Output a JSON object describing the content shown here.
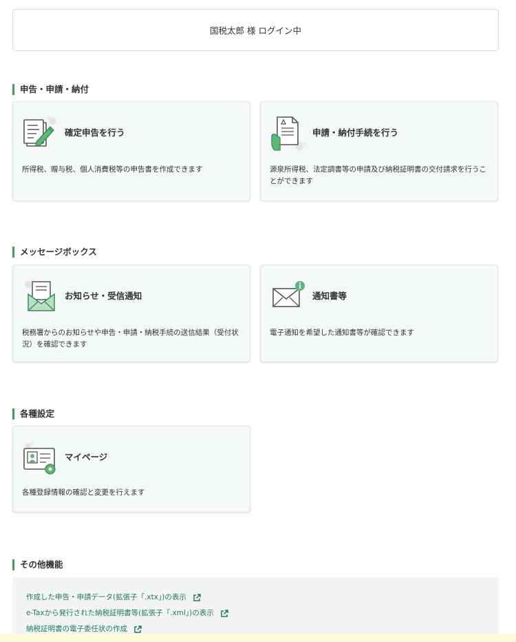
{
  "header": {
    "login_status": "国税太郎 様 ログイン中"
  },
  "sections": {
    "filing": {
      "title": "申告・申請・納付",
      "cards": [
        {
          "title": "確定申告を行う",
          "description": "所得税、贈与税、個人消費税等の申告書を作成できます",
          "icon": "document-pen-icon"
        },
        {
          "title": "申請・納付手続を行う",
          "description": "源泉所得税、法定調書等の申請及び納税証明書の交付請求を行うことができます",
          "icon": "hand-document-icon"
        }
      ]
    },
    "messagebox": {
      "title": "メッセージボックス",
      "cards": [
        {
          "title": "お知らせ・受信通知",
          "description": "税務署からのお知らせや申告・申請・納税手続の送信結果（受付状況）を確認できます",
          "icon": "envelope-letter-icon"
        },
        {
          "title": "通知書等",
          "description": "電子通知を希望した通知書等が確認できます",
          "icon": "envelope-info-icon"
        }
      ]
    },
    "settings": {
      "title": "各種設定",
      "cards": [
        {
          "title": "マイページ",
          "description": "各種登録情報の確認と変更を行えます",
          "icon": "id-card-gear-icon"
        }
      ]
    },
    "other": {
      "title": "その他機能",
      "links": [
        {
          "label": "作成した申告・申請データ(拡張子「.xtx」)の表示"
        },
        {
          "label": "e-Taxから発行された納税証明書等(拡張子「.xml」)の表示"
        },
        {
          "label": "納税証明書の電子委任状の作成"
        }
      ]
    }
  },
  "colors": {
    "accent": "#3aa05a",
    "link": "#1f7a5c",
    "card_bg": "#f5f8f9"
  }
}
